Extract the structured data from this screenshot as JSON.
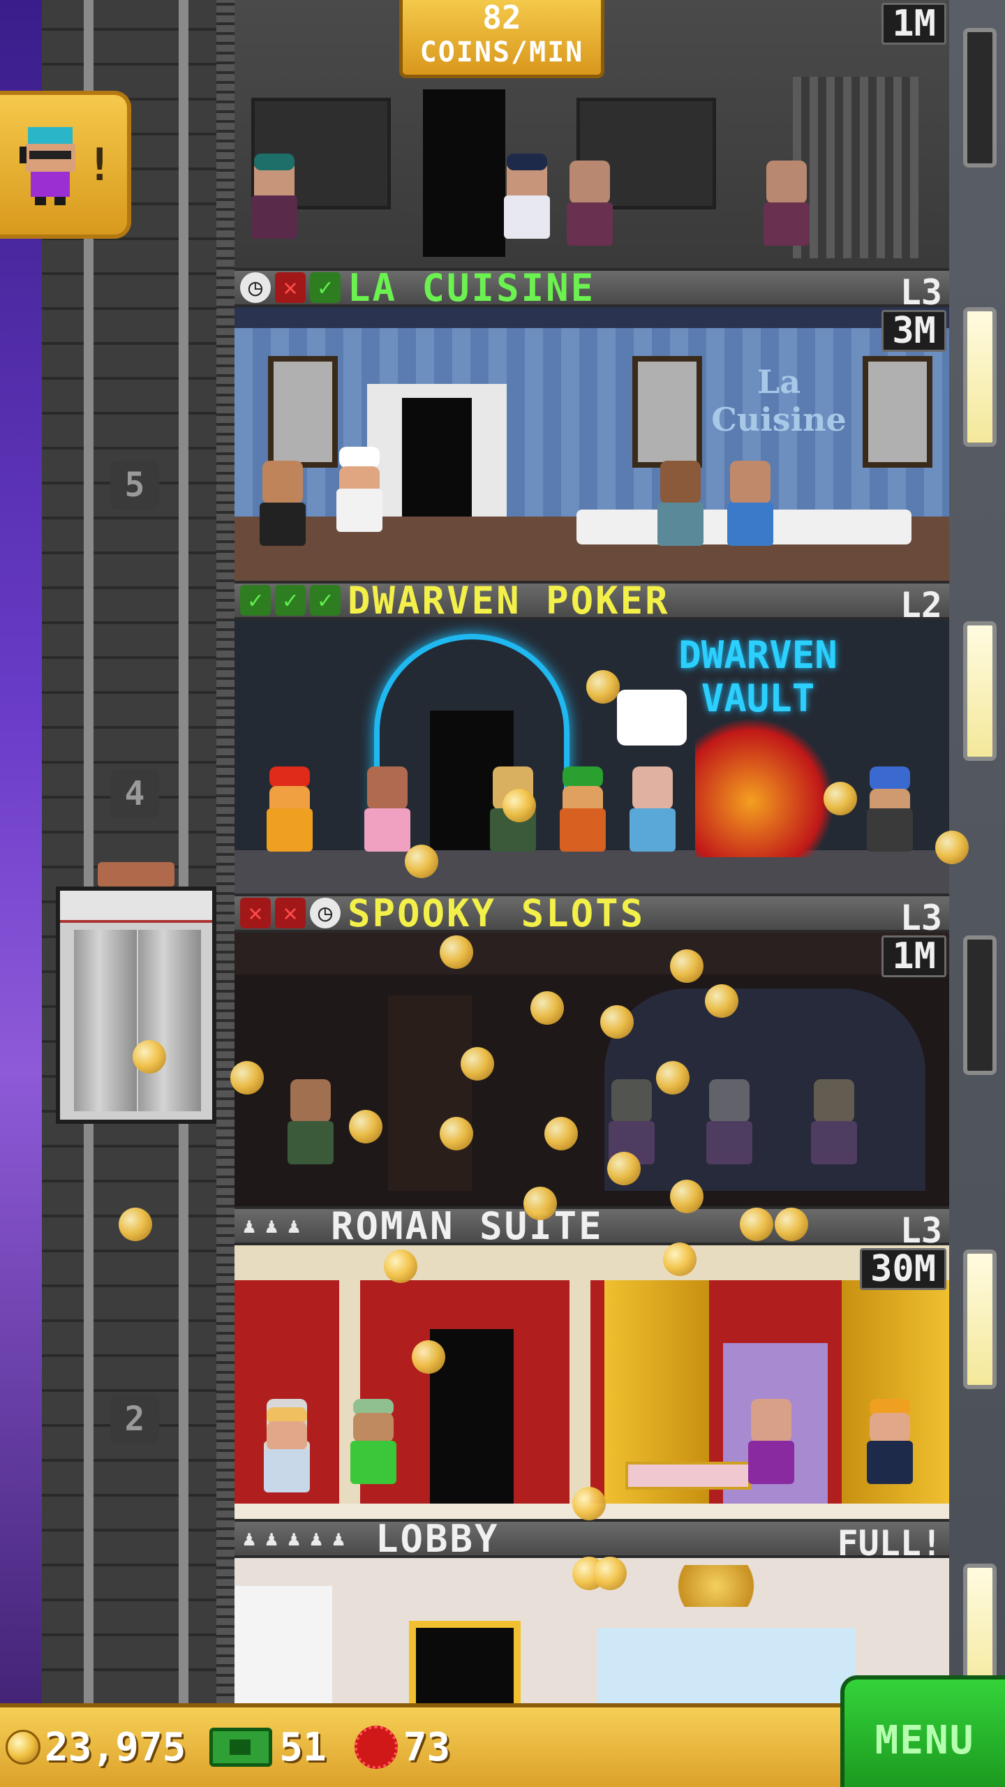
{
  "top_banner": {
    "coins_per_min_value": "82",
    "coins_per_min_label": "COINS/MIN",
    "top_floor_badge": "1M"
  },
  "shaft": {
    "floor_numbers": [
      "5",
      "4",
      "2"
    ]
  },
  "floors": [
    {
      "name": "LA CUISINE",
      "level": "L3",
      "badge": "3M",
      "name_color": "green",
      "status_icons": [
        "clock",
        "cross",
        "check"
      ],
      "sign": "La Cuisine"
    },
    {
      "name": "DWARVEN POKER",
      "level": "L2",
      "badge": "",
      "name_color": "yellow",
      "status_icons": [
        "check",
        "check",
        "check"
      ],
      "sign": "DWARVEN VAULT"
    },
    {
      "name": "SPOOKY SLOTS",
      "level": "L3",
      "badge": "1M",
      "name_color": "yellow",
      "status_icons": [
        "cross",
        "cross",
        "clock"
      ]
    },
    {
      "name": "ROMAN SUITE",
      "level": "L3",
      "badge": "30M",
      "name_color": "white",
      "status_icons": [
        "person",
        "person",
        "person"
      ]
    },
    {
      "name": "LOBBY",
      "level": "FULL!",
      "badge": "",
      "name_color": "white",
      "status_icons": [
        "person",
        "person",
        "person",
        "person",
        "person"
      ]
    }
  ],
  "bottom_bar": {
    "coins": "23,975",
    "bux": "51",
    "gems": "73",
    "menu_label": "MENU"
  },
  "colors": {
    "gold": "#f4c44a",
    "menu_green": "#2fc234",
    "floor_header": "#555555"
  }
}
